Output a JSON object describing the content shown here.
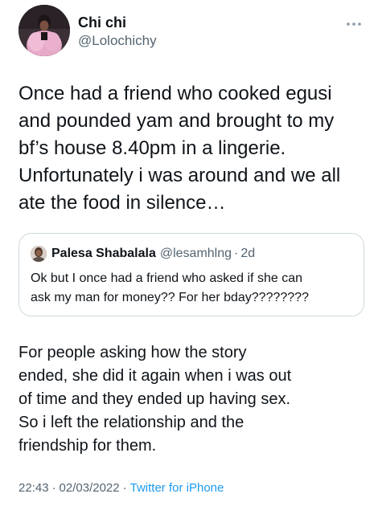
{
  "author": {
    "display_name": "Chi chi",
    "handle": "@Lolochichy"
  },
  "more_icon": "more-horizontal-icon",
  "tweet": {
    "text": "Once had a friend who cooked egusi\nand pounded yam and brought to my\nbf’s house 8.40pm in a lingerie.\nUnfortunately i was around and we all\nate the food in silence…"
  },
  "quoted_tweet": {
    "display_name": "Palesa Shabalala",
    "handle": "@lesamhlng",
    "separator": "·",
    "time": "2d",
    "text": "Ok but I once had a friend who asked if she can\nask my man for money?? For her bday????????"
  },
  "followup": {
    "text": "For people asking how the story\nended, she did it again when i was out\nof time and they ended up having sex.\nSo i left the relationship and the\nfriendship for them."
  },
  "meta": {
    "time": "22:43",
    "separator": "·",
    "date": "02/03/2022",
    "source": "Twitter for iPhone"
  },
  "colors": {
    "text": "#0f1419",
    "secondary": "#536471",
    "link": "#1d9bf0",
    "border": "#cfd9de"
  }
}
